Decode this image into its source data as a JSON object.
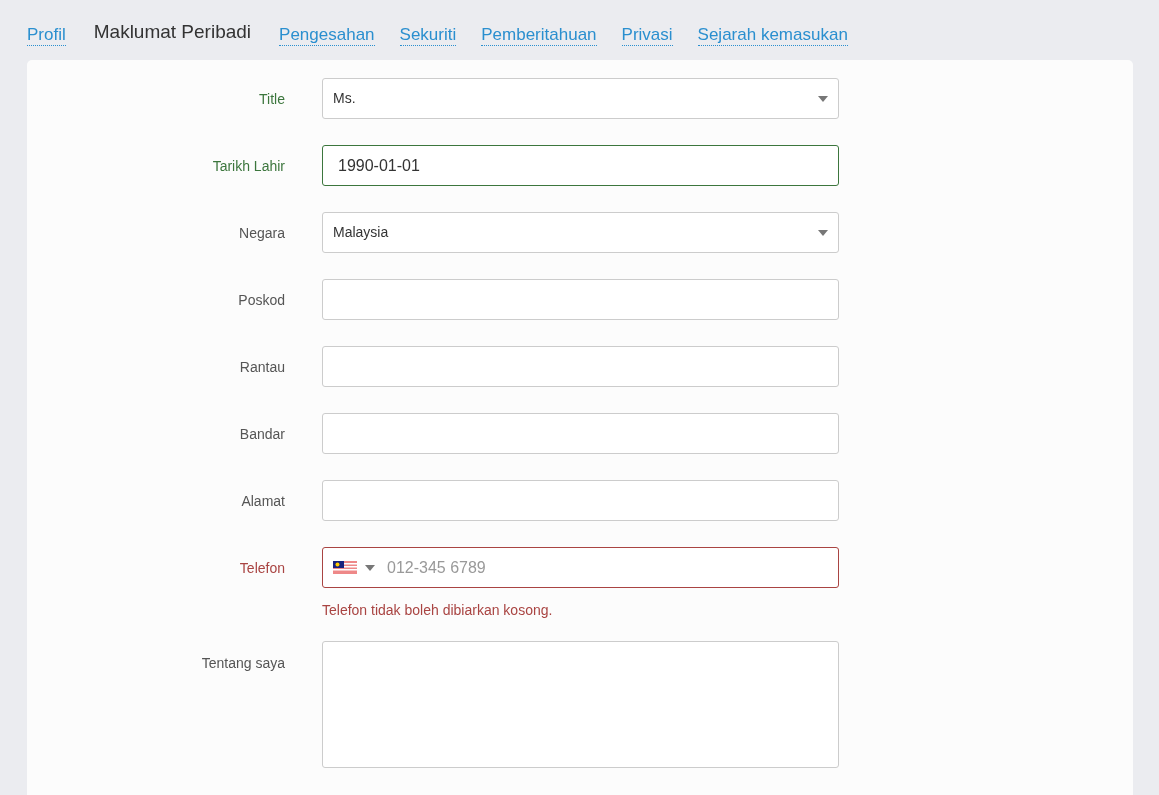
{
  "tabs": [
    {
      "label": "Profil",
      "selected": false
    },
    {
      "label": "Maklumat Peribadi",
      "selected": true
    },
    {
      "label": "Pengesahan",
      "selected": false
    },
    {
      "label": "Sekuriti",
      "selected": false
    },
    {
      "label": "Pemberitahuan",
      "selected": false
    },
    {
      "label": "Privasi",
      "selected": false
    },
    {
      "label": "Sejarah kemasukan",
      "selected": false
    }
  ],
  "fields": [
    {
      "label": "Title",
      "kind": "select",
      "value": "Ms.",
      "valid": true,
      "invalid": false,
      "focused": false
    },
    {
      "label": "Tarikh Lahir",
      "kind": "text",
      "value": "1990-01-01",
      "valid": true,
      "invalid": false,
      "focused": true
    },
    {
      "label": "Negara",
      "kind": "select",
      "value": "Malaysia",
      "valid": false,
      "invalid": false,
      "focused": false
    },
    {
      "label": "Poskod",
      "kind": "text",
      "valid": false,
      "invalid": false,
      "focused": false
    },
    {
      "label": "Rantau",
      "kind": "text",
      "valid": false,
      "invalid": false,
      "focused": false
    },
    {
      "label": "Bandar",
      "kind": "text",
      "valid": false,
      "invalid": false,
      "focused": false
    },
    {
      "label": "Alamat",
      "kind": "text",
      "valid": false,
      "invalid": false,
      "focused": false
    },
    {
      "label": "Telefon",
      "kind": "phone",
      "placeholder": "012-345 6789",
      "valid": false,
      "invalid": true,
      "focused": false,
      "error": "Telefon tidak boleh dibiarkan kosong."
    },
    {
      "label": "Tentang saya",
      "kind": "textarea",
      "valid": false,
      "invalid": false,
      "focused": false
    }
  ]
}
